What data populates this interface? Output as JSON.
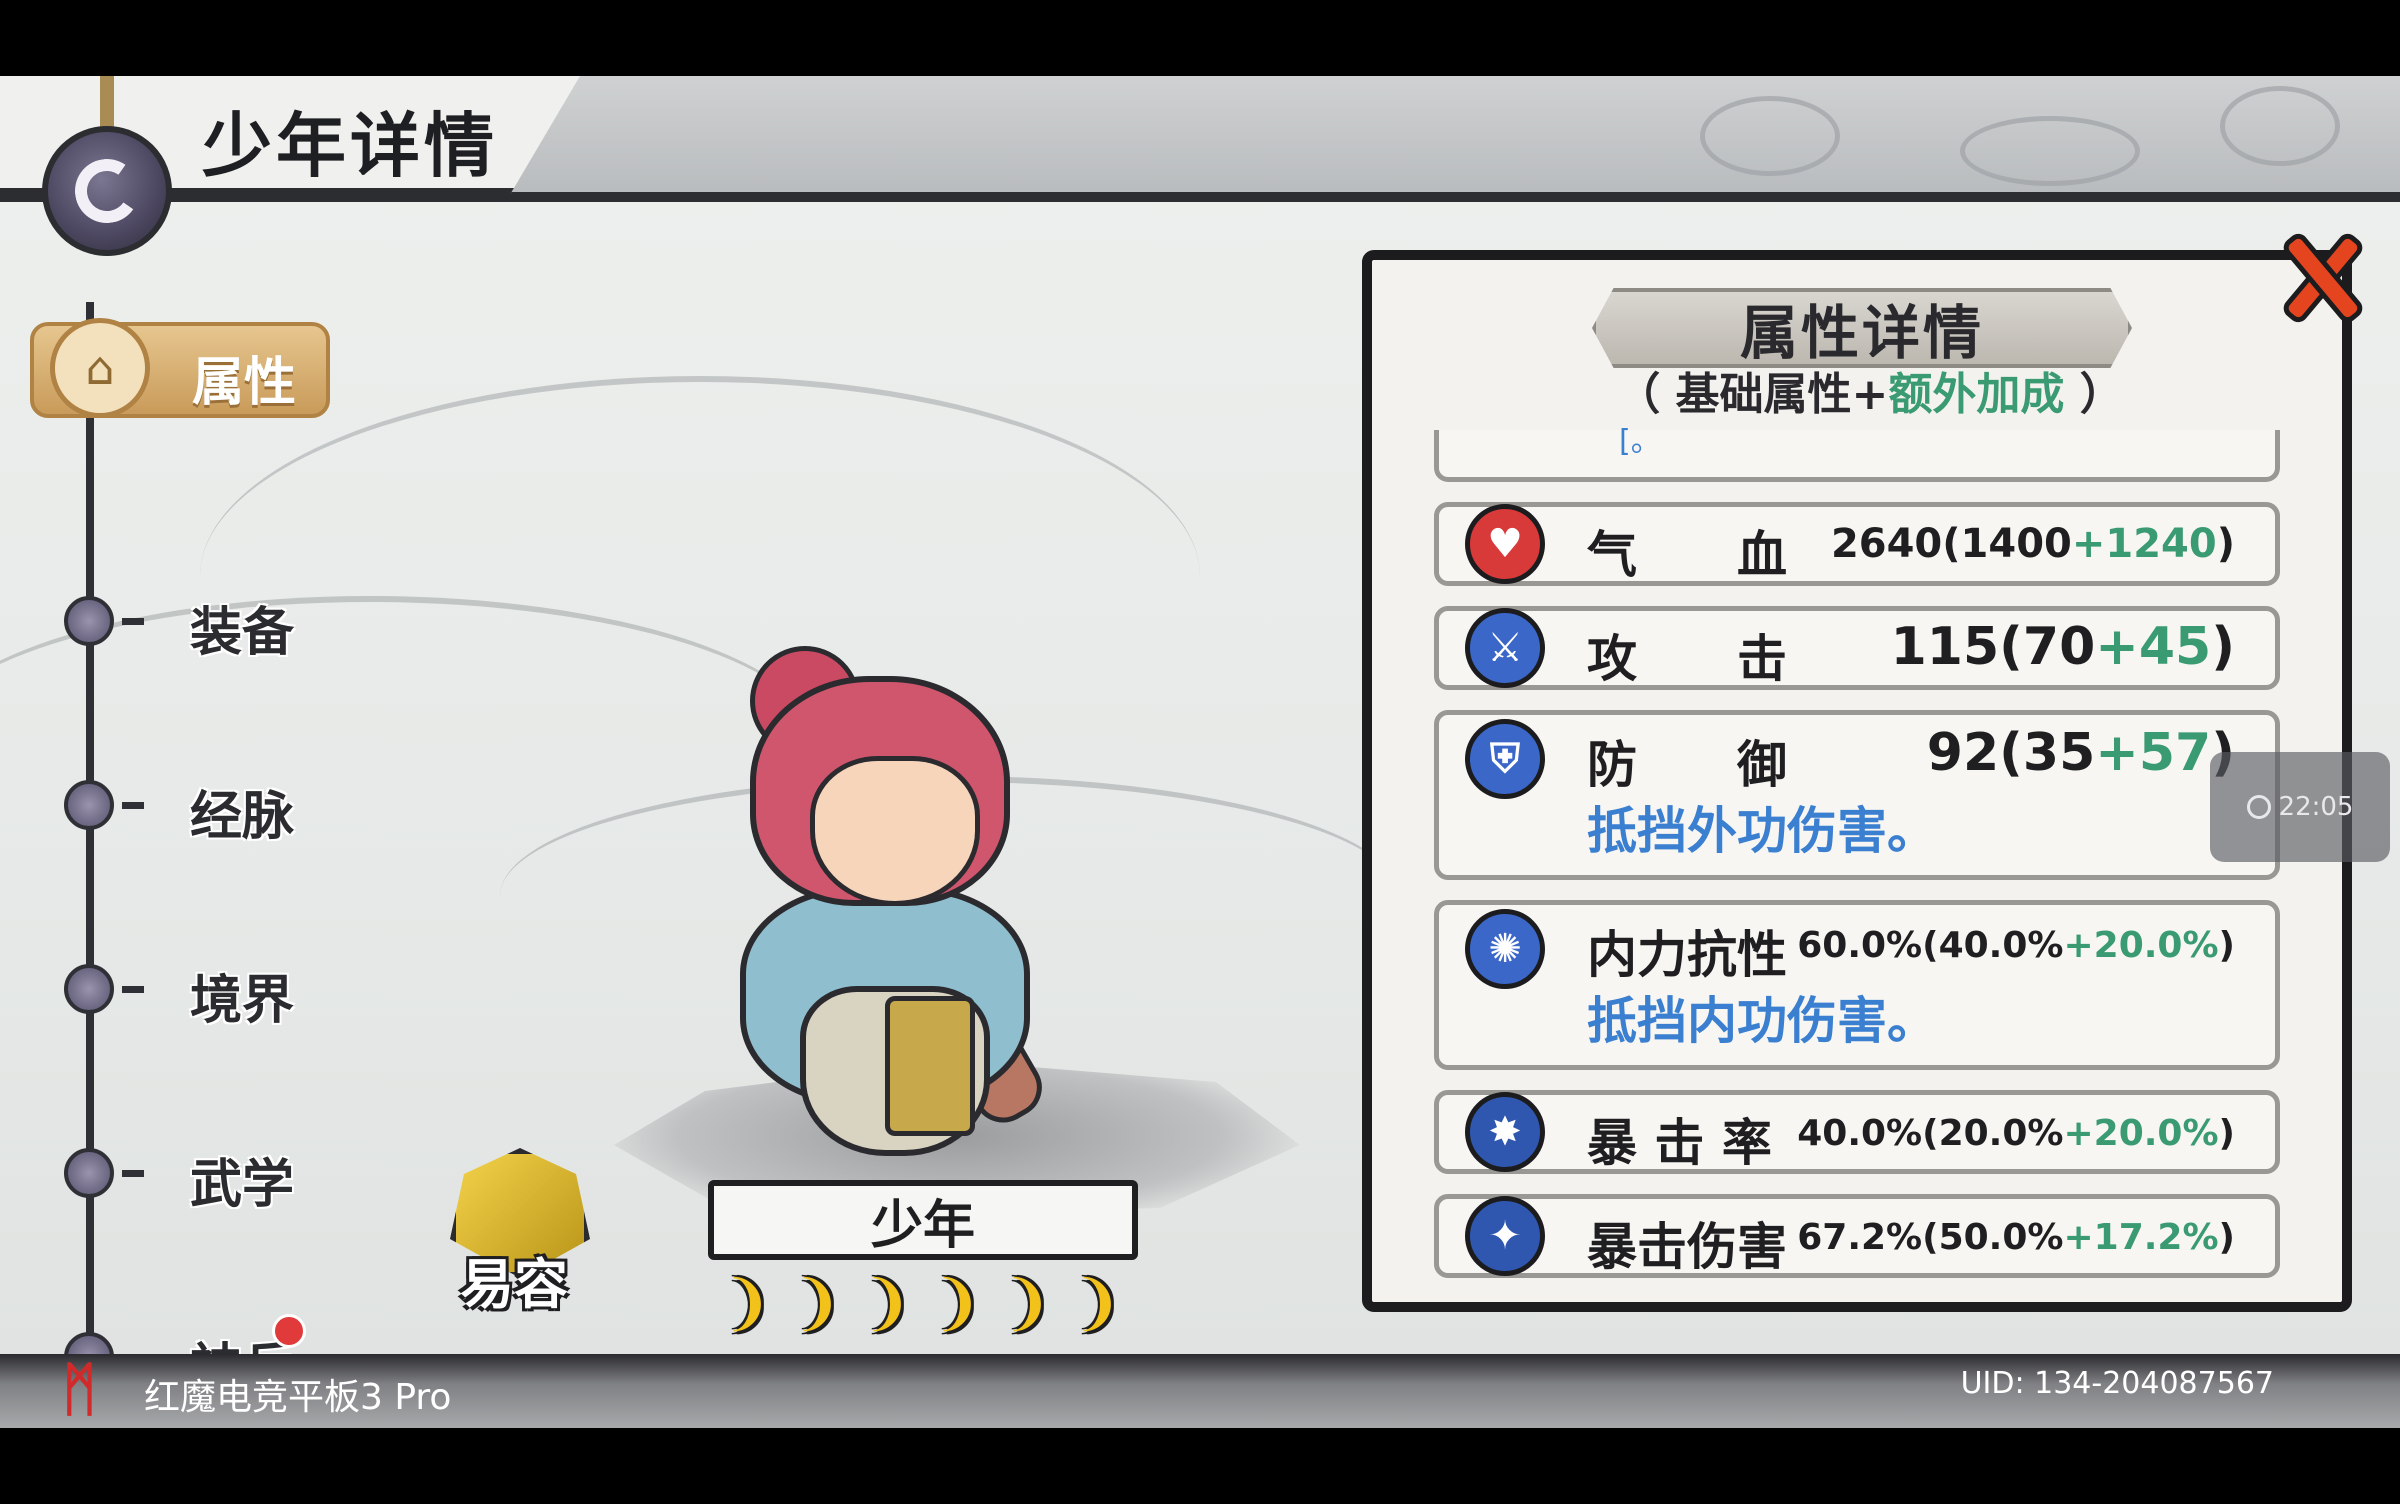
{
  "header": {
    "title": "少年详情"
  },
  "nav": {
    "active": {
      "label": "属性"
    },
    "items": [
      {
        "label": "装备",
        "badge": false
      },
      {
        "label": "经脉",
        "badge": false
      },
      {
        "label": "境界",
        "badge": false
      },
      {
        "label": "武学",
        "badge": false
      },
      {
        "label": "神兵",
        "badge": true
      }
    ]
  },
  "character": {
    "name": "少年",
    "disguise_label": "易容",
    "stars": [
      "❩",
      "❩",
      "❩",
      "❩",
      "❩",
      "❩"
    ]
  },
  "panel": {
    "title": "属性详情",
    "subtitle_left": "（ 基础属性+",
    "subtitle_green": "额外加成",
    "subtitle_right": " ）",
    "partial_text": "[。",
    "stats": [
      {
        "name": "气　　血",
        "total": "2640",
        "base": "1400",
        "bonus": "+1240",
        "desc": "",
        "icon": "heart-icon",
        "color": "#d83a3a"
      },
      {
        "name": "攻　　击",
        "total": "115",
        "base": "70",
        "bonus": "+45",
        "desc": "",
        "icon": "sword-icon",
        "color": "#3a67c8"
      },
      {
        "name": "防　　御",
        "total": "92",
        "base": "35",
        "bonus": "+57",
        "desc": "抵挡外功伤害。",
        "icon": "shield-icon",
        "color": "#3a67c8"
      },
      {
        "name": "内力抗性",
        "total": "60.0%",
        "base": "40.0%",
        "bonus": "+20.0%",
        "desc": "抵挡内功伤害。",
        "icon": "swirl-icon",
        "color": "#3a67c8"
      },
      {
        "name": "暴 击 率",
        "total": "40.0%",
        "base": "20.0%",
        "bonus": "+20.0%",
        "desc": "",
        "icon": "crit-icon",
        "color": "#2f57b0"
      },
      {
        "name": "暴击伤害",
        "total": "67.2%",
        "base": "50.0%",
        "bonus": "+17.2%",
        "desc": "",
        "icon": "crit-damage-icon",
        "color": "#2f57b0"
      }
    ]
  },
  "overlay": {
    "clock": "22:05"
  },
  "footer": {
    "device": "红魔电竞平板3 Pro",
    "uid": "UID:  134-204087567"
  },
  "colors": {
    "accent_green": "#3a9a72",
    "desc_blue": "#3b7fd0",
    "close_red": "#e4451f"
  }
}
